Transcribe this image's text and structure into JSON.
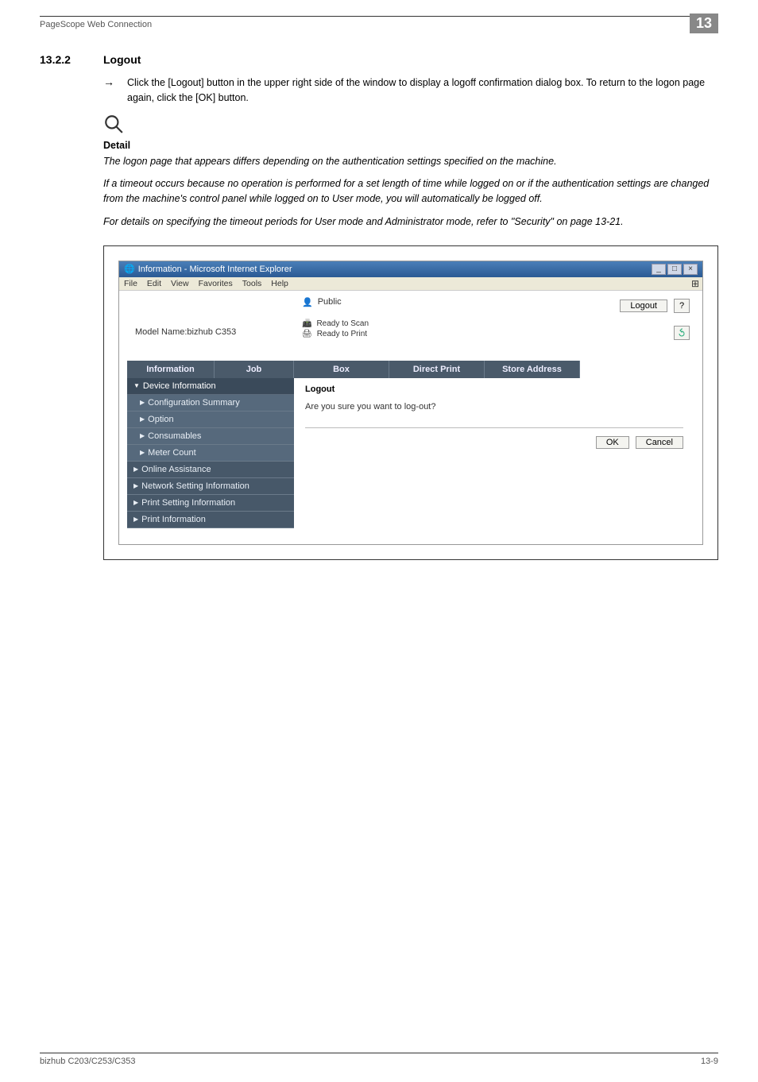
{
  "header": {
    "breadcrumb": "PageScope Web Connection",
    "chapter": "13"
  },
  "section": {
    "number": "13.2.2",
    "title": "Logout"
  },
  "instruction": {
    "arrow": "→",
    "text": "Click the [Logout] button in the upper right side of the window to display a logoff confirmation dialog box. To return to the logon page again, click the [OK] button."
  },
  "detail": {
    "label": "Detail",
    "p1": "The logon page that appears differs depending on the authentication settings specified on the machine.",
    "p2": "If a timeout occurs because no operation is performed for a set length of time while logged on or if the authentication settings are changed from the machine's control panel while logged on to User mode, you will automatically be logged off.",
    "p3": "For details on specifying the timeout periods for User mode and Administrator mode, refer to \"Security\" on page 13-21."
  },
  "ie": {
    "title": "Information - Microsoft Internet Explorer",
    "menus": [
      "File",
      "Edit",
      "View",
      "Favorites",
      "Tools",
      "Help"
    ],
    "user_label": "Public",
    "logout_btn": "Logout",
    "help_symbol": "?",
    "model": "Model Name:bizhub C353",
    "status1": "Ready to Scan",
    "status2": "Ready to Print",
    "tabs": {
      "info": "Information",
      "job": "Job",
      "box": "Box",
      "dp": "Direct Print",
      "sa": "Store Address"
    },
    "sidebar": {
      "grp1": "Device Information",
      "cfg": "Configuration Summary",
      "opt": "Option",
      "cons": "Consumables",
      "meter": "Meter Count",
      "online": "Online Assistance",
      "net": "Network Setting Information",
      "printset": "Print Setting Information",
      "printinfo": "Print Information"
    },
    "pane": {
      "title": "Logout",
      "msg": "Are you sure you want to log-out?",
      "ok": "OK",
      "cancel": "Cancel"
    }
  },
  "footer": {
    "left": "bizhub C203/C253/C353",
    "right": "13-9"
  }
}
